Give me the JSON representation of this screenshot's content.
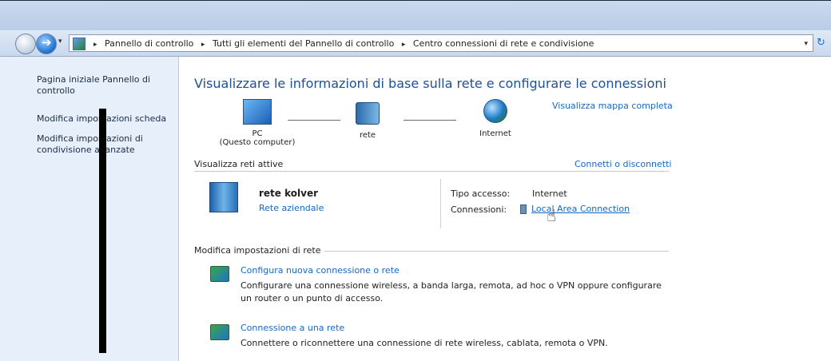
{
  "window": {
    "accent": "#1f4f96",
    "link_color": "#1767c7"
  },
  "nav": {
    "back_icon": "back-arrow-icon",
    "forward_icon": "forward-arrow-icon",
    "forward_glyph": "➔",
    "dropdown_glyph": "▾"
  },
  "address": {
    "crumbs": [
      "Pannello di controllo",
      "Tutti gli elementi del Pannello di controllo",
      "Centro connessioni di rete e condivisione"
    ],
    "separator": "▸",
    "dropdown_glyph": "▾",
    "refresh_glyph": "↻"
  },
  "sidebar": {
    "items": [
      {
        "label": "Pagina iniziale Pannello di controllo"
      },
      {
        "label": "Modifica impostazioni scheda"
      },
      {
        "label": "Modifica impostazioni di condivisione avanzate"
      }
    ]
  },
  "main": {
    "title": "Visualizzare le informazioni di base sulla rete e configurare le connessioni",
    "full_map_link": "Visualizza mappa completa",
    "map": {
      "pc_label": "PC",
      "pc_sub": "(Questo computer)",
      "network_label": "rete",
      "internet_label": "Internet"
    },
    "active_networks": {
      "heading": "Visualizza reti attive",
      "connect_link": "Connetti o disconnetti",
      "network_name": "rete kolver",
      "network_type": "Rete aziendale",
      "access_type_label": "Tipo accesso:",
      "access_type_value": "Internet",
      "connections_label": "Connessioni:",
      "connection_link": "Local Area Connection"
    },
    "change_settings": {
      "heading": "Modifica impostazioni di rete",
      "tasks": [
        {
          "title": "Configura nuova connessione o rete",
          "description": "Configurare una connessione wireless, a banda larga, remota, ad hoc o VPN oppure configurare un router o un punto di accesso."
        },
        {
          "title": "Connessione a una rete",
          "description": "Connettere o riconnettere una connessione di rete wireless, cablata, remota o VPN."
        }
      ]
    }
  }
}
